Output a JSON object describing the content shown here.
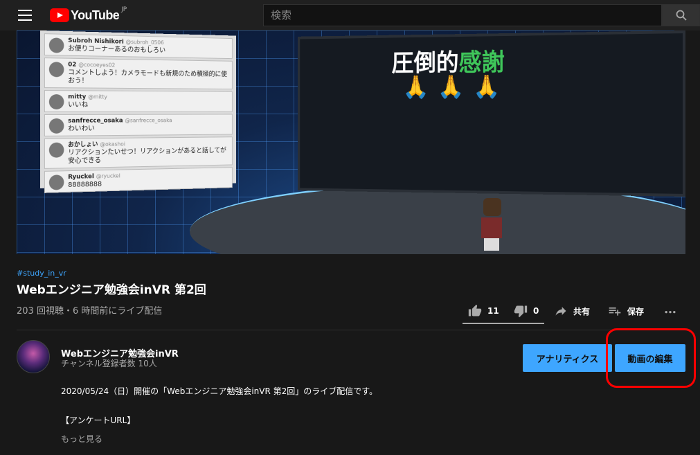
{
  "header": {
    "logo_text": "YouTube",
    "logo_region": "JP",
    "search_placeholder": "検索"
  },
  "video": {
    "screen_text_white": "圧倒的",
    "screen_text_green": "感謝",
    "screen_emoji": "🙏🙏🙏",
    "comments": [
      {
        "name": "Subroh Nishikori",
        "handle": "@subroh_0506",
        "text": "お便りコーナーあるのおもしろい"
      },
      {
        "name": "02",
        "handle": "@cocoeyes02",
        "text": "コメントしよう！カメラモードも新規のため積極的に使おう！"
      },
      {
        "name": "mitty",
        "handle": "@mitty",
        "text": "いいね"
      },
      {
        "name": "sanfrecce_osaka",
        "handle": "@sanfrecce_osaka",
        "text": "わいわい"
      },
      {
        "name": "おかしょい",
        "handle": "@okashoi",
        "text": "リアクションたいせつ！リアクションがあると話してが安心できる"
      },
      {
        "name": "Ryuckel",
        "handle": "@ryuckel",
        "text": "88888888"
      }
    ]
  },
  "info": {
    "hashtag": "#study_in_vr",
    "title": "Webエンジニア勉強会inVR 第2回",
    "views": "203 回視聴・6 時間前にライブ配信",
    "like_count": "11",
    "dislike_count": "0",
    "like_ratio": 1.0,
    "share_label": "共有",
    "save_label": "保存"
  },
  "channel": {
    "name": "Webエンジニア勉強会inVR",
    "subscribers": "チャンネル登録者数 10人",
    "analytics_label": "アナリティクス",
    "edit_label": "動画の編集"
  },
  "description": {
    "line1": "2020/05/24（日）開催の「Webエンジニア勉強会inVR 第2回」のライブ配信です。",
    "line2": "【アンケートURL】",
    "show_more": "もっと見る"
  },
  "colors": {
    "accent": "#3ea6ff",
    "annotation_ring": "#ff0000",
    "brand": "#ff0000"
  }
}
